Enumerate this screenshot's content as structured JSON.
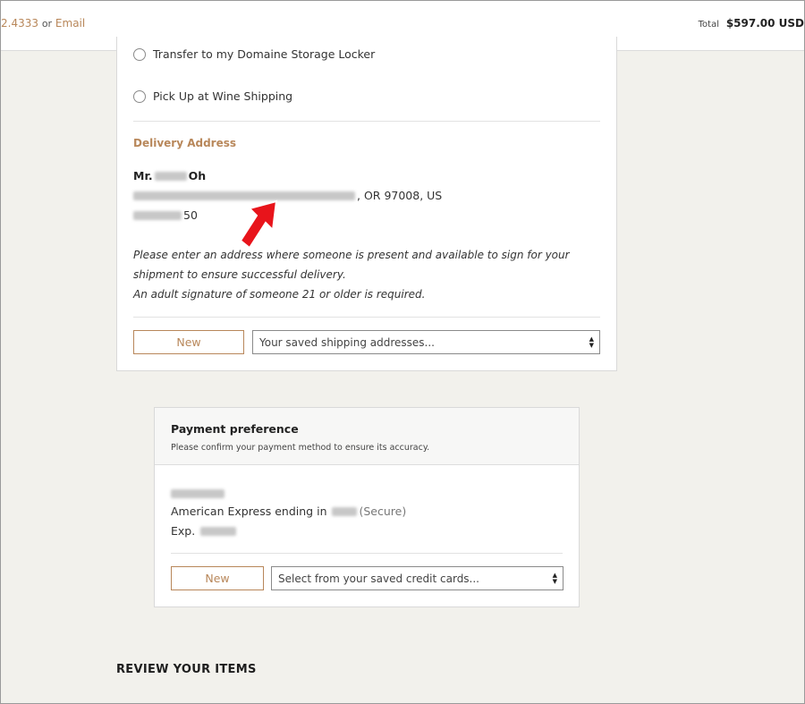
{
  "header": {
    "phone_fragment": "2.4333",
    "or_text": "or",
    "email_link": "Email",
    "total_label": "Total",
    "total_amount": "$597.00 USD"
  },
  "shipping": {
    "options": [
      {
        "label": "Transfer to my Domaine Storage Locker",
        "selected": false
      },
      {
        "label": "Pick Up at Wine Shipping",
        "selected": false
      }
    ],
    "delivery_heading": "Delivery Address",
    "name_prefix": "Mr.",
    "name_suffix": "Oh",
    "address_suffix": ", OR 97008, US",
    "phone_suffix": "50",
    "note_line1": "Please enter an address where someone is present and available to sign for your shipment to ensure successful delivery.",
    "note_line2": "An adult signature of someone 21 or older is required.",
    "new_button": "New",
    "saved_select_placeholder": "Your saved shipping addresses..."
  },
  "payment": {
    "title": "Payment preference",
    "subtitle": "Please confirm your payment method to ensure its accuracy.",
    "card_text": "American Express ending in",
    "secure_text": "(Secure)",
    "exp_label": "Exp.",
    "new_button": "New",
    "saved_select_placeholder": "Select from your saved credit cards..."
  },
  "review_heading": "REVIEW YOUR ITEMS",
  "colors": {
    "accent": "#b8875a",
    "annotation_arrow": "#e8141b",
    "page_bg": "#f2f1ec"
  }
}
